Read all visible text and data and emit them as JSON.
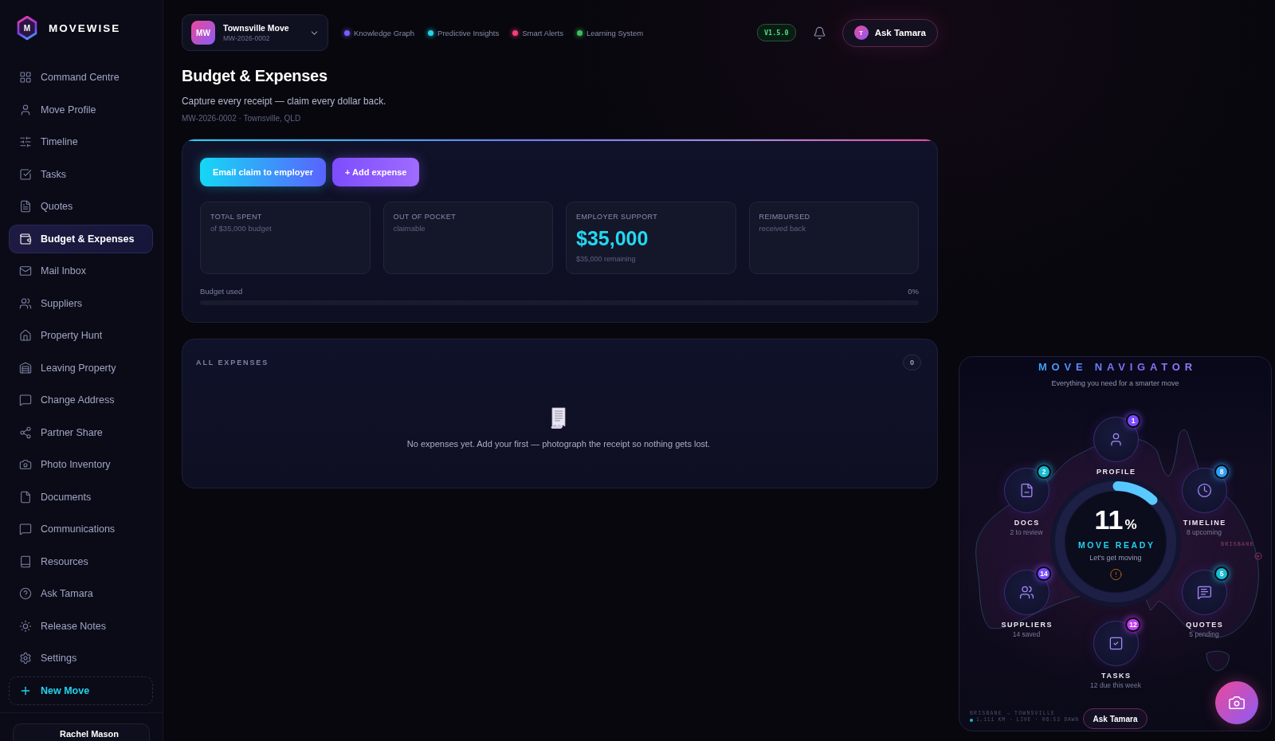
{
  "sidebar": {
    "brand": {
      "mark": "M",
      "name": "MOVEWISE"
    },
    "items": [
      {
        "label": "Command Centre",
        "selected": false
      },
      {
        "label": "Move Profile",
        "selected": false
      },
      {
        "label": "Timeline",
        "selected": false
      },
      {
        "label": "Tasks",
        "selected": false
      },
      {
        "label": "Quotes",
        "selected": false
      },
      {
        "label": "Budget & Expenses",
        "selected": true
      },
      {
        "label": "Mail Inbox",
        "selected": false
      },
      {
        "label": "Suppliers",
        "selected": false
      },
      {
        "label": "Property Hunt",
        "selected": false
      },
      {
        "label": "Leaving Property",
        "selected": false
      },
      {
        "label": "Change Address",
        "selected": false
      },
      {
        "label": "Partner Share",
        "selected": false
      },
      {
        "label": "Photo Inventory",
        "selected": false
      },
      {
        "label": "Documents",
        "selected": false
      },
      {
        "label": "Communications",
        "selected": false
      },
      {
        "label": "Resources",
        "selected": false
      },
      {
        "label": "Ask Tamara",
        "selected": false
      },
      {
        "label": "Release Notes",
        "selected": false
      },
      {
        "label": "Settings",
        "selected": false
      }
    ],
    "new_move": "New Move",
    "user": {
      "name": "Rachel Mason"
    }
  },
  "header": {
    "move_selector": {
      "initials": "MW",
      "name": "Townsville Move",
      "code": "MW-2026-0002"
    },
    "systems": [
      {
        "label": "Knowledge Graph",
        "color": "#7c5cff"
      },
      {
        "label": "Predictive Insights",
        "color": "#22d3ee"
      },
      {
        "label": "Smart Alerts",
        "color": "#f43f7a"
      },
      {
        "label": "Learning System",
        "color": "#3fbf5f"
      }
    ],
    "version": "V1.5.0",
    "assistant_button": {
      "initial": "T",
      "label": "Ask Tamara"
    }
  },
  "page": {
    "title": "Budget & Expenses",
    "subtitle": "Capture every receipt — claim every dollar back.",
    "meta": "MW-2026-0002 · Townsville, QLD"
  },
  "budget": {
    "actions": [
      {
        "kind": "primary",
        "label": "Email claim to employer"
      },
      {
        "kind": "secondary",
        "label": "+ Add expense"
      }
    ],
    "stats": [
      {
        "label": "TOTAL SPENT",
        "detail": "of $35,000 budget"
      },
      {
        "label": "OUT OF POCKET",
        "detail": "claimable"
      },
      {
        "label": "EMPLOYER SUPPORT",
        "value": "$35,000",
        "note": "$35,000 remaining"
      },
      {
        "label": "REIMBURSED",
        "detail": "received back"
      }
    ],
    "usage": {
      "label": "Budget used",
      "reading": "0%"
    }
  },
  "expenses": {
    "title": "ALL EXPENSES",
    "count": "0",
    "empty_message": "No expenses yet. Add your first — photograph the receipt so nothing gets lost."
  },
  "navigator": {
    "title": "MOVE NAVIGATOR",
    "subtitle": "Everything you need for a smarter move",
    "readiness": {
      "value": "11",
      "unit": "%",
      "level": 0.11,
      "label": "MOVE READY",
      "caption": "Let's get moving"
    },
    "nodes": [
      {
        "label": "PROFILE",
        "badge": "1",
        "color": "#7c4dff"
      },
      {
        "label": "DOCS",
        "detail": "2 to review",
        "badge": "2",
        "color": "#17bcd4"
      },
      {
        "label": "TIMELINE",
        "detail": "8 upcoming",
        "badge": "8",
        "color": "#2ea0f5"
      },
      {
        "label": "SUPPLIERS",
        "detail": "14 saved",
        "badge": "14",
        "color": "#7c4dff"
      },
      {
        "label": "QUOTES",
        "detail": "5 pending",
        "badge": "5",
        "color": "#17bcd4"
      },
      {
        "label": "TASKS",
        "detail": "12 due this week",
        "badge": "12",
        "color": "#c13df0"
      }
    ],
    "map_label": "BRISBANE",
    "route": "BRISBANE → TOWNSVILLE",
    "status": "1,111 KM · LIVE · 06:53 DAWN",
    "assistant_button": "Ask Tamara"
  }
}
